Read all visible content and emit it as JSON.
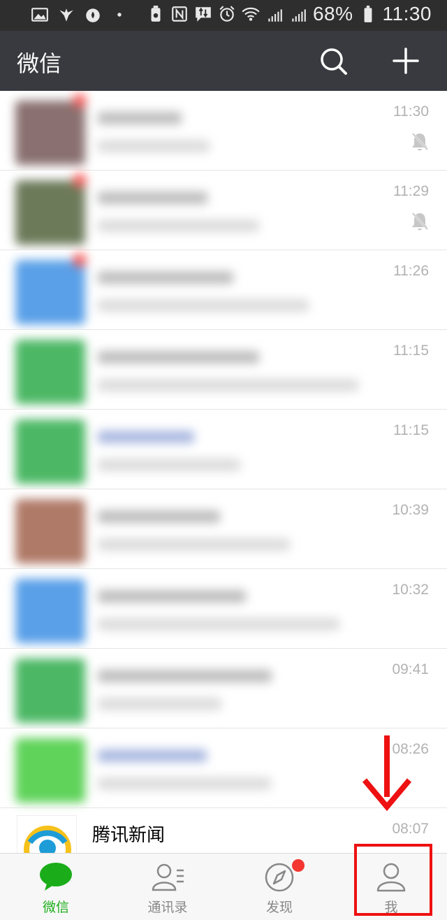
{
  "status_bar": {
    "battery": "68%",
    "time": "11:30",
    "left_icons": [
      "image-icon",
      "bird-icon",
      "flame-icon",
      "dot-icon"
    ],
    "right_icons": [
      "battery-saver-icon",
      "nfc-icon",
      "data-transfer-icon",
      "alarm-icon",
      "wifi-icon",
      "signal-4g-icon",
      "signal-2g-icon",
      "battery-icon"
    ]
  },
  "header": {
    "title": "微信",
    "search_icon": "search-icon",
    "add_icon": "plus-icon",
    "background": "#393a3f"
  },
  "chats": [
    {
      "time": "11:30",
      "muted": true,
      "badge": true,
      "avatar_color": "#8a7070"
    },
    {
      "time": "11:29",
      "muted": true,
      "badge": true,
      "avatar_color": "#6d7a5a"
    },
    {
      "time": "11:26",
      "muted": false,
      "badge": true,
      "avatar_color": "#5aa0e8"
    },
    {
      "time": "11:15",
      "muted": false,
      "badge": false,
      "avatar_color": "#4cb865"
    },
    {
      "time": "11:15",
      "muted": false,
      "badge": false,
      "avatar_color": "#4cb865"
    },
    {
      "time": "10:39",
      "muted": false,
      "badge": false,
      "avatar_color": "#b07a68"
    },
    {
      "time": "10:32",
      "muted": false,
      "badge": false,
      "avatar_color": "#5aa0e8"
    },
    {
      "time": "09:41",
      "muted": false,
      "badge": false,
      "avatar_color": "#4cb865"
    },
    {
      "time": "08:26",
      "muted": false,
      "badge": false,
      "avatar_color": "#5fd35a"
    }
  ],
  "news_chat": {
    "name": "腾讯新闻",
    "time": "08:07",
    "avatar_icon": "tencent-news-icon"
  },
  "tabs": [
    {
      "label": "微信",
      "icon": "chat-bubble-icon",
      "active": true
    },
    {
      "label": "通讯录",
      "icon": "contacts-icon",
      "active": false
    },
    {
      "label": "发现",
      "icon": "compass-icon",
      "active": false,
      "red_dot": true
    },
    {
      "label": "我",
      "icon": "person-icon",
      "active": false
    }
  ],
  "colors": {
    "active_tab": "#1aad19",
    "inactive_tab": "#888888",
    "annotation": "#ee1111"
  }
}
